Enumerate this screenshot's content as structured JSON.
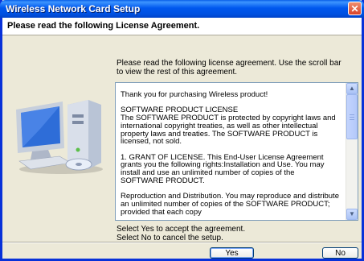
{
  "window": {
    "title": "Wireless Network Card Setup",
    "close_symbol": "✕"
  },
  "header": {
    "title": "Please read the following License Agreement."
  },
  "instructions": "Please read the following license agreement. Use the scroll bar to view the rest of this agreement.",
  "license": {
    "text": "Thank you for purchasing Wireless product!\n\nSOFTWARE PRODUCT LICENSE\nThe SOFTWARE PRODUCT is protected by copyright laws and international copyright treaties, as well as other intellectual property laws and treaties. The SOFTWARE PRODUCT is licensed, not sold.\n\n1. GRANT OF LICENSE. This End-User License Agreement grants you the following rights:Installation and Use. You may install and use an unlimited number of copies of the SOFTWARE PRODUCT.\n\nReproduction and Distribution. You may reproduce and distribute an unlimited number of copies of the SOFTWARE PRODUCT; provided that each copy"
  },
  "prompt": {
    "line1": "Select Yes to accept the agreement.",
    "line2": "Select No to cancel the setup."
  },
  "buttons": {
    "yes": "Yes",
    "no": "No"
  },
  "scroll": {
    "up_arrow": "▲",
    "down_arrow": "▼",
    "position": 0
  },
  "colors": {
    "titlebar": "#0058EE",
    "background": "#ECE9D8"
  }
}
